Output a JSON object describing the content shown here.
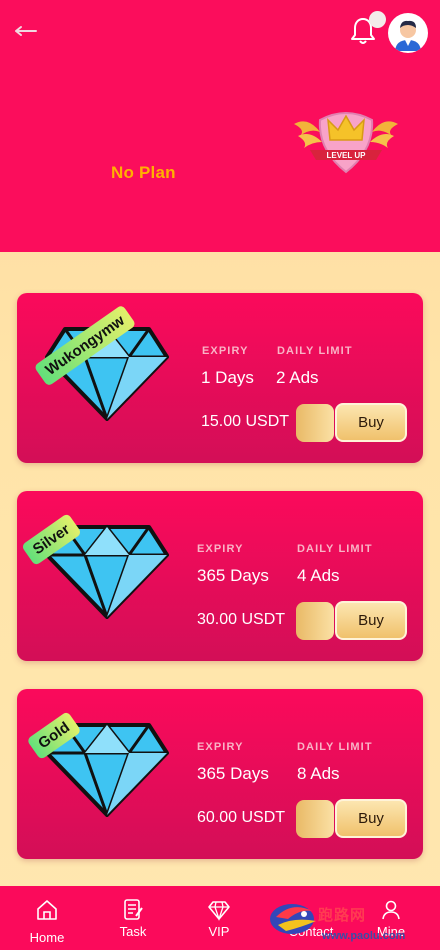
{
  "header": {
    "plan_status": "No Plan",
    "badge_text": "LEVEL UP",
    "colors": {
      "primary": "#fb0d5c",
      "plan_text": "#ffb000"
    }
  },
  "plans": [
    {
      "tag": "Wukongymw",
      "expiry_label": "EXPIRY",
      "expiry_value": "1 Days",
      "limit_label": "DAILY LIMIT",
      "limit_value": "2 Ads",
      "price": "15.00 USDT",
      "buy_label": "Buy"
    },
    {
      "tag": "Silver",
      "expiry_label": "EXPIRY",
      "expiry_value": "365 Days",
      "limit_label": "DAILY LIMIT",
      "limit_value": "4 Ads",
      "price": "30.00 USDT",
      "buy_label": "Buy"
    },
    {
      "tag": "Gold",
      "expiry_label": "EXPIRY",
      "expiry_value": "365 Days",
      "limit_label": "DAILY LIMIT",
      "limit_value": "8 Ads",
      "price": "60.00 USDT",
      "buy_label": "Buy"
    }
  ],
  "nav": {
    "home": "Home",
    "task": "Task",
    "vip": "VIP",
    "contact": "Contact",
    "mine": "Mine"
  },
  "watermark": {
    "text": "跑路网",
    "url": "www.paolu.com"
  },
  "icons": [
    "back-icon",
    "bell-icon",
    "avatar",
    "diamond-icon",
    "home-icon",
    "task-icon",
    "vip-icon",
    "contact-icon",
    "mine-icon"
  ]
}
